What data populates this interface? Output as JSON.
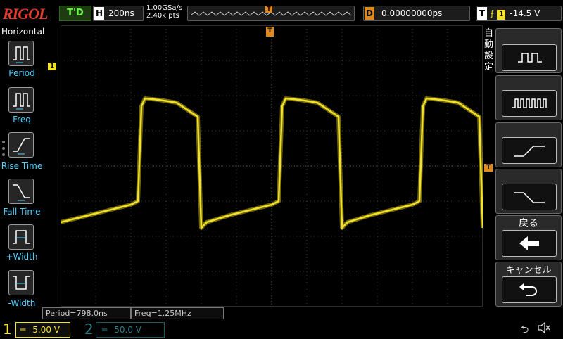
{
  "brand": "RIGOL",
  "run_status": "T'D",
  "horizontal": {
    "tag": "H",
    "timebase": "200ns",
    "sample_rate": "1.00GSa/s",
    "memory_depth": "2.40k pts"
  },
  "trigger_pos_marker": "T",
  "delay": {
    "tag": "D",
    "value": "0.00000000ps"
  },
  "trigger": {
    "tag": "T",
    "edge_icon": "rising-edge-icon",
    "channel": "1",
    "level": "-14.5 V"
  },
  "left_menu": {
    "title": "Horizontal",
    "items": [
      {
        "label": "Period",
        "icon": "period-measure-icon"
      },
      {
        "label": "Freq",
        "icon": "frequency-measure-icon"
      },
      {
        "label": "Rise Time",
        "icon": "rise-time-icon"
      },
      {
        "label": "Fall Time",
        "icon": "fall-time-icon"
      },
      {
        "label": "+Width",
        "icon": "positive-width-icon"
      },
      {
        "label": "-Width",
        "icon": "negative-width-icon"
      }
    ]
  },
  "right_menu": {
    "auto_label": "自動設定",
    "back_label": "戻る",
    "cancel_label": "キャンセル",
    "buttons": [
      "multi-cycle-icon",
      "single-cycle-icon",
      "rising-edge-wave-icon",
      "falling-edge-wave-icon"
    ]
  },
  "channel_marker": "1",
  "trigger_level_marker": "T",
  "measurements": {
    "period": "Period=798.0ns",
    "freq": "Freq=1.25MHz"
  },
  "channels": [
    {
      "number": "1",
      "coupling_icon": "dc-coupling-icon",
      "scale": "5.00 V",
      "color": "#f4e12a"
    },
    {
      "number": "2",
      "coupling_icon": "dc-coupling-icon",
      "scale": "50.0 V",
      "color": "#2a7f86"
    }
  ],
  "status_icons": [
    "usb-icon",
    "speaker-muted-icon"
  ],
  "colors": {
    "trace": "#f4e12a",
    "grid": "#3a3a3a",
    "trigger_marker": "#e08a1e",
    "menu_label": "#4fd0ff"
  },
  "chart_data": {
    "type": "line",
    "x": [
      0,
      0.16,
      0.4,
      0.44,
      0.46,
      0.48,
      0.56,
      0.66,
      0.78,
      0.8,
      0.83,
      0.96,
      1.2,
      1.24,
      1.26,
      1.28,
      1.36,
      1.46,
      1.58,
      1.6,
      1.63,
      1.76,
      2.0,
      2.04,
      2.06,
      2.08,
      2.16,
      2.26,
      2.38,
      2.4
    ],
    "series": [
      {
        "values": [
          -8.0,
          -7.0,
          -5.5,
          -5.0,
          8.5,
          9.6,
          9.4,
          9.0,
          7.0,
          -8.8,
          -8.0,
          -7.0,
          -5.5,
          -5.0,
          8.5,
          9.6,
          9.4,
          9.0,
          7.0,
          -8.8,
          -8.0,
          -7.0,
          -5.5,
          -5.0,
          8.5,
          9.6,
          9.4,
          9.0,
          7.0,
          -8.8
        ]
      }
    ],
    "xlim": [
      0,
      2.4
    ],
    "ylim": [
      -20,
      20
    ],
    "grid": true
  }
}
